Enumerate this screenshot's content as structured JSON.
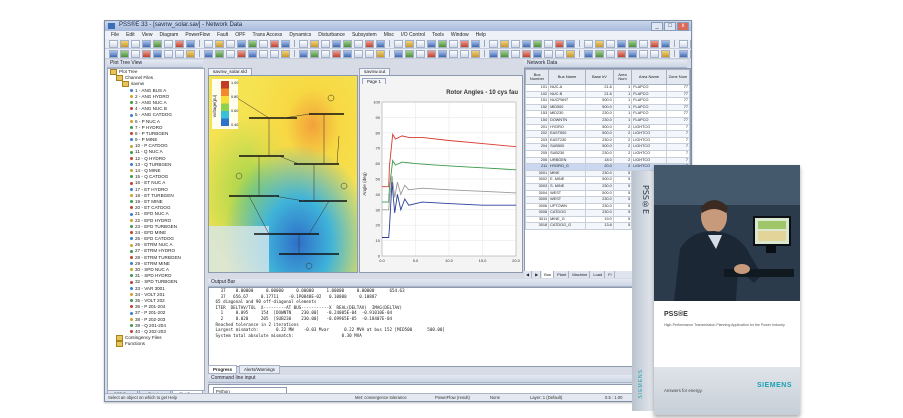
{
  "window": {
    "title": "PSS®E 33 - [savnw_solar.sav] - Network Data",
    "menus": [
      "File",
      "Edit",
      "View",
      "Diagram",
      "PowerFlow",
      "Fault",
      "OPF",
      "Trans Access",
      "Dynamics",
      "Disturbance",
      "Subsystem",
      "Misc",
      "I/O Control",
      "Tools",
      "Window",
      "Help"
    ],
    "buttons": {
      "minimize": "_",
      "maximize": "□",
      "close": "x"
    }
  },
  "tree": {
    "title": "Plot Tree View",
    "root": "Plot Tree",
    "channel_files": "Channel Files",
    "file": "savnw",
    "channels": [
      "1 - ANG BUS A",
      "2 - ANG HYDRO",
      "3 - ANG NUC A",
      "4 - ANG NUC B",
      "5 - ANG CATDOG",
      "6 - P NUC A",
      "7 - P HYDRO",
      "8 - P TURBGEN",
      "9 - P MINE",
      "10 - P CATDOG",
      "11 - Q NUC A",
      "12 - Q HYDRO",
      "13 - Q TURBGEN",
      "14 - Q MINE",
      "15 - Q CATDOG",
      "16 - ET NUC A",
      "17 - ET HYDRO",
      "18 - ET TURBGEN",
      "19 - ET MINE",
      "20 - ET CATDOG",
      "21 - EFD NUC A",
      "22 - EFD HYDRO",
      "23 - EFD TURBGEN",
      "24 - EFD MINE",
      "25 - EFD CATDOG",
      "26 - ETRM NUC A",
      "27 - ETRM HYDRO",
      "28 - ETRM TURBGEN",
      "29 - ETRM MINE",
      "30 - SPD NUC A",
      "31 - SPD HYDRO",
      "32 - SPD TURBGEN",
      "33 - VAR 3001",
      "34 - VOLT 201",
      "35 - VOLT 202",
      "36 - P 201-204",
      "37 - P 201-202",
      "38 - P 202-203",
      "39 - Q 201-204",
      "40 - Q 202-203"
    ],
    "contingency_files": "Contingency Files",
    "functions": "Functions",
    "tabs": [
      "DPF Tree",
      "Tabular",
      "Plot Tree"
    ],
    "active_tab": "Plot Tree"
  },
  "map": {
    "tab": "savnw_solar.sld",
    "legend_label": "voltage(pu)",
    "legend_ticks": [
      "1.00",
      "0.80",
      "0.60",
      "0.40"
    ],
    "legend_colors": [
      "#c23b22",
      "#f08a2c",
      "#f7df3a",
      "#8fd14f",
      "#37c0d7",
      "#2e73c9"
    ]
  },
  "plot": {
    "tab": "savnw.out",
    "page_tab": "Page 1",
    "title": "Rotor Angles - 10 cys fau",
    "ylabel": "Angle (deg)",
    "yticks": [
      "100",
      "90",
      "80",
      "70",
      "60",
      "50",
      "40",
      "30",
      "20",
      "10",
      "0"
    ],
    "xticks": [
      "0.0",
      "5.0",
      "10.0",
      "15.0",
      "20.0"
    ]
  },
  "chart_data": {
    "type": "line",
    "title": "Rotor Angles - 10 cys fau",
    "xlabel": "",
    "ylabel": "Angle (deg)",
    "xlim": [
      0,
      20
    ],
    "ylim": [
      0,
      100
    ],
    "series": [
      {
        "color": "#d83a2e",
        "x": [
          0,
          1.0,
          1.1,
          1.6,
          2.0,
          3.0,
          4.0,
          6.0,
          10.0,
          15.0,
          20.0
        ],
        "y": [
          45,
          45,
          58,
          79,
          76,
          78,
          77,
          77,
          75,
          73,
          71
        ]
      },
      {
        "color": "#3a9a49",
        "x": [
          0,
          1.0,
          1.1,
          1.6,
          2.0,
          3.0,
          5.0,
          8.0,
          12.0,
          16.0,
          20.0
        ],
        "y": [
          35,
          35,
          44,
          62,
          59,
          61,
          60,
          59,
          58,
          57,
          56
        ]
      },
      {
        "color": "#9a9a9a",
        "x": [
          0,
          1.0,
          1.1,
          1.5,
          1.9,
          2.3,
          2.8,
          3.4,
          4.0,
          6.0,
          10.0,
          15.0,
          20.0
        ],
        "y": [
          30,
          30,
          36,
          52,
          38,
          48,
          40,
          46,
          43,
          44,
          43,
          42,
          41
        ]
      },
      {
        "color": "#2a3f9a",
        "x": [
          0,
          1.0,
          1.1,
          1.5,
          1.9,
          2.3,
          2.8,
          3.4,
          4.0,
          6.0,
          10.0,
          15.0,
          20.0
        ],
        "y": [
          12,
          12,
          18,
          48,
          28,
          40,
          30,
          37,
          33,
          35,
          34,
          33,
          33
        ]
      }
    ]
  },
  "grid": {
    "title": "Network Data",
    "columns": [
      "Bus Number",
      "Bus Name",
      "Base kV",
      "Area Num",
      "Area Name",
      "Zone Num"
    ],
    "rows": [
      [
        "101",
        "NUC-A",
        "21.6",
        "1",
        "FLAPCO",
        "77"
      ],
      [
        "102",
        "NUC-B",
        "21.6",
        "1",
        "FLAPCO",
        "77"
      ],
      [
        "151",
        "NUCPANT",
        "500.0",
        "1",
        "FLAPCO",
        "77"
      ],
      [
        "152",
        "MID500",
        "500.0",
        "1",
        "FLAPCO",
        "77"
      ],
      [
        "153",
        "MID230",
        "230.0",
        "1",
        "FLAPCO",
        "77"
      ],
      [
        "154",
        "DOWNTN",
        "230.0",
        "1",
        "FLAPCO",
        "77"
      ],
      [
        "201",
        "HYDRO",
        "500.0",
        "2",
        "LIGHTCO",
        "7"
      ],
      [
        "202",
        "EAST500",
        "500.0",
        "2",
        "LIGHTCO",
        "7"
      ],
      [
        "203",
        "EAST230",
        "230.0",
        "2",
        "LIGHTCO",
        "7"
      ],
      [
        "204",
        "SUB500",
        "500.0",
        "2",
        "LIGHTCO",
        "7"
      ],
      [
        "205",
        "SUB230",
        "230.0",
        "2",
        "LIGHTCO",
        "7"
      ],
      [
        "206",
        "URBGEN",
        "18.0",
        "2",
        "LIGHTCO",
        "7"
      ],
      [
        "211",
        "HYDRO_G",
        "20.0",
        "2",
        "LIGHTCO",
        "7"
      ],
      [
        "3001",
        "MINE",
        "230.0",
        "5",
        "WORLD",
        "5"
      ],
      [
        "3002",
        "E. MINE",
        "500.0",
        "5",
        "WORLD",
        "5"
      ],
      [
        "3003",
        "S. MINE",
        "230.0",
        "5",
        "WORLD",
        "5"
      ],
      [
        "3004",
        "WEST",
        "500.0",
        "5",
        "WORLD",
        "5"
      ],
      [
        "3005",
        "WEST",
        "230.0",
        "5",
        "WORLD",
        "5"
      ],
      [
        "3006",
        "UPTOWN",
        "230.0",
        "5",
        "WORLD",
        "5"
      ],
      [
        "3008",
        "CATDOG",
        "230.0",
        "5",
        "WORLD",
        "5"
      ],
      [
        "3011",
        "MINE_G",
        "19.0",
        "5",
        "WORLD",
        "5"
      ],
      [
        "3018",
        "CATDOG_G",
        "13.8",
        "5",
        "WORLD",
        "5"
      ]
    ],
    "tabs": [
      "Bus",
      "Plant",
      "Machine",
      "Load",
      "Fi"
    ],
    "active_tab": "Bus"
  },
  "output": {
    "title": "Output Bar",
    "lines": [
      "   37    0.00000     0.00000     0.00000     1.00000     0.00000      654.63",
      "   37   656.67     0.17711    -0.1P0848E-02   0.10000     0.10887",
      "",
      " 65 diagonal and 90 off-diagonal elements",
      "",
      " ITER  DELTAV/TOL  X---------AT BUS-----------X  REAL(DELTAV)  IMAG(DELTAV)",
      "   1     0.095     154  [DOWNTN    230.00]   -0.24005E-04  -0.91010E-04",
      "   2     0.020     205  [SUB230    230.00]   -0.69965E-05  -0.18407E-04",
      "",
      " Reached tolerance in 2 iterations",
      "",
      " Largest mismatch:       0.22 MW    -0.03 Mvar      0.22 MVA at bus 152 [MID500      500.00]",
      " System total absolute mismatch:                   0.30 MVA"
    ],
    "tabs": [
      "Progress",
      "Alerts/Warnings"
    ],
    "active_tab": "Progress"
  },
  "command": {
    "title": "Command line input",
    "mode": "Python"
  },
  "statusbar": {
    "left": "Select an object on which to get Help",
    "items": [
      "Met: convergence tolerance",
      "PowerFlow (result)",
      "None",
      "Layer: 1 (Default)",
      "0.5 : 1.00",
      "Area Ident"
    ]
  },
  "product_box": {
    "spine_logo": "PSS®E",
    "title": "PSS®E",
    "subtitle": "High-Performance Transmission Planning Application for the Power Industry",
    "tagline": "Answers for energy.",
    "brand": "SIEMENS",
    "accent": "#1a9fb2"
  }
}
